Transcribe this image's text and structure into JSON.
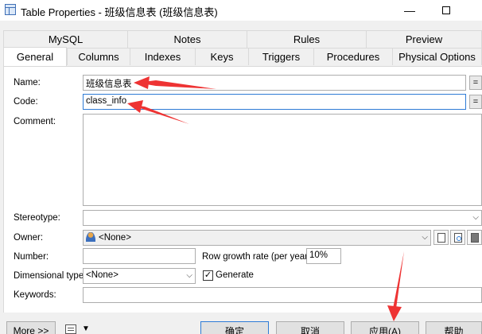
{
  "window": {
    "title": "Table Properties - 班级信息表 (班级信息表)",
    "minimize_glyph": "—"
  },
  "tabs": {
    "row1": [
      "MySQL",
      "Notes",
      "Rules",
      "Preview"
    ],
    "row2": [
      "General",
      "Columns",
      "Indexes",
      "Keys",
      "Triggers",
      "Procedures",
      "Physical Options"
    ],
    "active": "General"
  },
  "form": {
    "name_label": "Name:",
    "name_value": "班级信息表",
    "code_label": "Code:",
    "code_value": "class_info",
    "comment_label": "Comment:",
    "stereotype_label": "Stereotype:",
    "stereotype_value": "",
    "owner_label": "Owner:",
    "owner_value": "<None>",
    "number_label": "Number:",
    "number_value": "",
    "growth_label": "Row growth rate (per year):",
    "growth_value": "10%",
    "dimensional_label": "Dimensional type:",
    "dimensional_value": "<None>",
    "generate_label": "Generate",
    "generate_checked": true,
    "keywords_label": "Keywords:",
    "keywords_value": "",
    "eq_glyph": "="
  },
  "buttons": {
    "more": "More >>",
    "ok": "确定",
    "cancel": "取消",
    "apply": "应用(A)",
    "help": "帮助"
  },
  "colors": {
    "annotation": "#ee3333",
    "focus": "#2e7bd6"
  }
}
